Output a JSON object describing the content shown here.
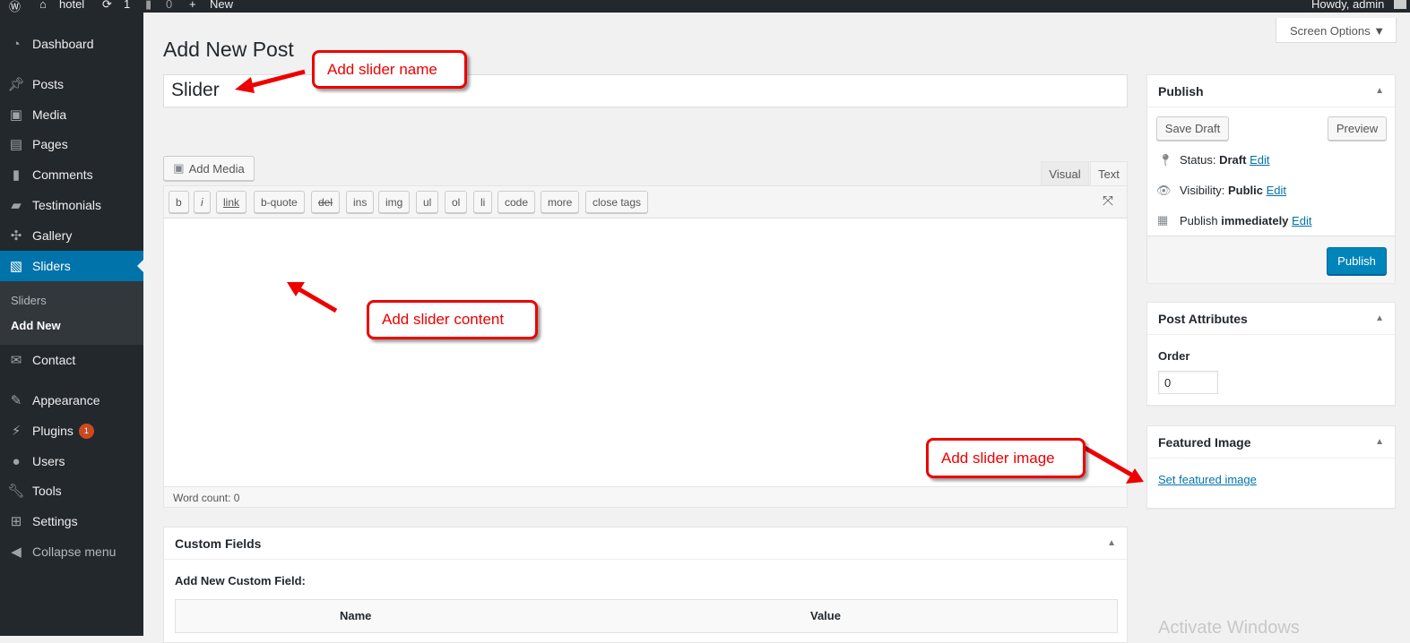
{
  "adminbar": {
    "site": "hotel",
    "updates": "1",
    "comments": "0",
    "new": "New",
    "howdy": "Howdy, admin"
  },
  "sidebar": {
    "items": [
      {
        "label": "Dashboard",
        "icon": "dashboard-icon"
      },
      {
        "label": "Posts",
        "icon": "pin-icon"
      },
      {
        "label": "Media",
        "icon": "media-icon"
      },
      {
        "label": "Pages",
        "icon": "pages-icon"
      },
      {
        "label": "Comments",
        "icon": "comment-icon"
      },
      {
        "label": "Testimonials",
        "icon": "testimonial-icon"
      },
      {
        "label": "Gallery",
        "icon": "gallery-icon"
      },
      {
        "label": "Sliders",
        "icon": "slider-icon"
      },
      {
        "label": "Contact",
        "icon": "mail-icon"
      },
      {
        "label": "Appearance",
        "icon": "brush-icon"
      },
      {
        "label": "Plugins",
        "icon": "plugin-icon",
        "badge": "1"
      },
      {
        "label": "Users",
        "icon": "user-icon"
      },
      {
        "label": "Tools",
        "icon": "wrench-icon"
      },
      {
        "label": "Settings",
        "icon": "settings-icon"
      },
      {
        "label": "Collapse menu",
        "icon": "collapse-icon"
      }
    ],
    "submenu": [
      "Sliders",
      "Add New"
    ]
  },
  "page": {
    "title": "Add New Post",
    "post_title": "Slider",
    "screen_options": "Screen Options"
  },
  "editor": {
    "add_media": "Add Media",
    "tab_visual": "Visual",
    "tab_text": "Text",
    "buttons": [
      "b",
      "i",
      "link",
      "b-quote",
      "del",
      "ins",
      "img",
      "ul",
      "ol",
      "li",
      "code",
      "more",
      "close tags"
    ],
    "word_count": "Word count: 0"
  },
  "custom_fields": {
    "title": "Custom Fields",
    "add_label": "Add New Custom Field:",
    "col_name": "Name",
    "col_value": "Value"
  },
  "publish": {
    "title": "Publish",
    "save_draft": "Save Draft",
    "preview": "Preview",
    "status_label": "Status:",
    "status": "Draft",
    "visibility_label": "Visibility:",
    "visibility": "Public",
    "publish_label": "Publish",
    "publish_when": "immediately",
    "edit": "Edit",
    "publish_button": "Publish"
  },
  "attributes": {
    "title": "Post Attributes",
    "order_label": "Order",
    "order": "0"
  },
  "featured": {
    "title": "Featured Image",
    "link": "Set featured image"
  },
  "annotations": {
    "name": "Add slider name",
    "content": "Add slider content",
    "image": "Add slider image"
  },
  "watermark": "Activate Windows",
  "colors": {
    "accent": "#0073aa",
    "annotation": "#ee0000",
    "sidebar": "#23282d"
  }
}
